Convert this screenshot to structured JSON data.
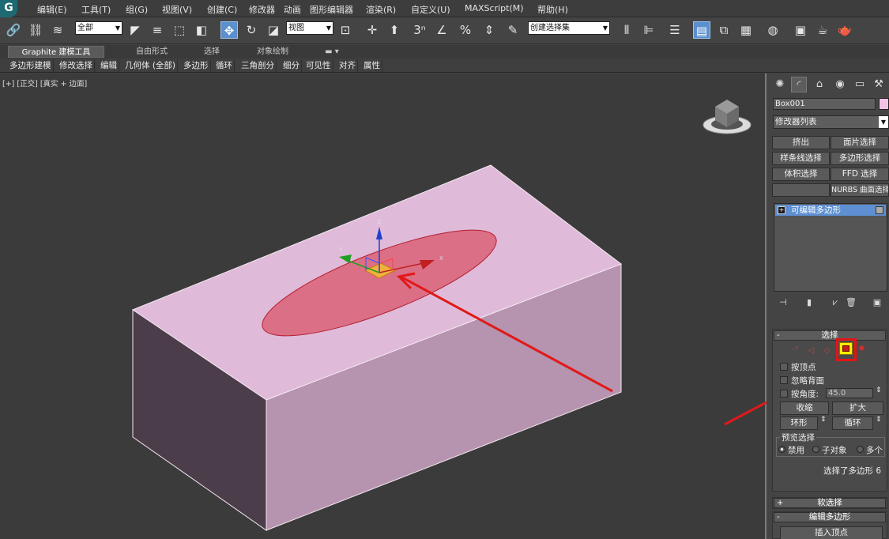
{
  "app": {
    "logo": "G",
    "menu": [
      "编辑(E)",
      "工具(T)",
      "组(G)",
      "视图(V)",
      "创建(C)",
      "修改器",
      "动画",
      "图形编辑器",
      "渲染(R)",
      "自定义(U)",
      "MAXScript(M)",
      "帮助(H)"
    ]
  },
  "toolbar": {
    "filter_select": "全部",
    "refcoord_select": "视图",
    "named_selection_select": "创建选择集",
    "snap_label": "3"
  },
  "ribbon": {
    "tabs": [
      "Graphite 建模工具",
      "自由形式",
      "选择",
      "对象绘制"
    ],
    "buttons": [
      "多边形建模",
      "修改选择",
      "编辑",
      "几何体 (全部)",
      "多边形",
      "循环",
      "三角剖分",
      "细分",
      "可见性",
      "对齐",
      "属性"
    ]
  },
  "viewport": {
    "label": "[+] [正交] [真实 + 边面]",
    "gizmo_axes": {
      "z": "Z",
      "x": "X",
      "y": "Y"
    },
    "box_color": "#dfbbd9",
    "selection_color": "#d64a5b",
    "arrow_color": "#e11919"
  },
  "command_panel": {
    "object_name": "Box001",
    "object_color": "#f1c1e6",
    "modifier_list": "修改器列表",
    "modifier_buttons": [
      "挤出",
      "面片选择",
      "样条线选择",
      "多边形选择",
      "体积选择",
      "FFD 选择",
      "",
      "NURBS 曲面选择"
    ],
    "stack_item": "可编辑多边形",
    "selection_rollout": {
      "title": "选择",
      "by_vertex": "按顶点",
      "ignore_backfacing": "忽略背面",
      "by_angle": "按角度:",
      "angle_value": "45.0",
      "shrink": "收缩",
      "grow": "扩大",
      "ring": "环形",
      "loop": "循环",
      "preview_group": "预览选择",
      "preview_off": "禁用",
      "preview_subobject": "子对象",
      "preview_multi": "多个",
      "status": "选择了多边形 6"
    },
    "soft_selection": "软选择",
    "edit_polygons": "编辑多边形",
    "insert_vertex": "插入顶点"
  }
}
